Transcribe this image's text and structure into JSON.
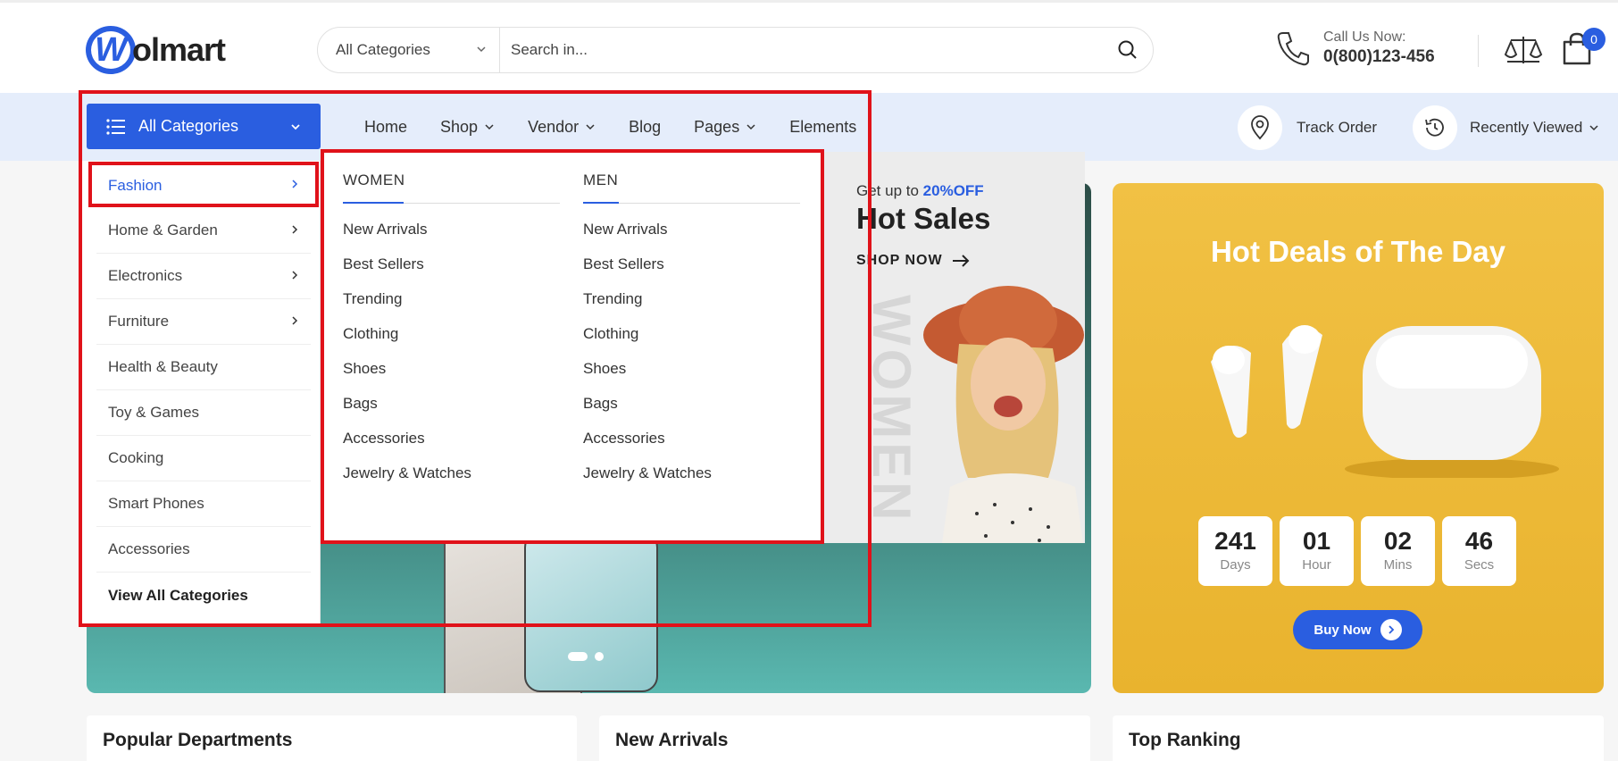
{
  "header": {
    "logo_text": "olmart",
    "logo_mark": "W",
    "search": {
      "category": "All Categories",
      "placeholder": "Search in..."
    },
    "call_label": "Call Us Now:",
    "call_number": "0(800)123-456",
    "cart_count": "0"
  },
  "nav": {
    "all_categories": "All Categories",
    "links": [
      "Home",
      "Shop",
      "Vendor",
      "Blog",
      "Pages",
      "Elements"
    ],
    "track_order": "Track Order",
    "recently_viewed": "Recently Viewed"
  },
  "categories": [
    "Fashion",
    "Home & Garden",
    "Electronics",
    "Furniture",
    "Health & Beauty",
    "Toy & Games",
    "Cooking",
    "Smart Phones",
    "Accessories",
    "View All Categories"
  ],
  "mega_menu": {
    "women": {
      "heading": "WOMEN",
      "links": [
        "New Arrivals",
        "Best Sellers",
        "Trending",
        "Clothing",
        "Shoes",
        "Bags",
        "Accessories",
        "Jewelry & Watches"
      ]
    },
    "men": {
      "heading": "MEN",
      "links": [
        "New Arrivals",
        "Best Sellers",
        "Trending",
        "Clothing",
        "Shoes",
        "Bags",
        "Accessories",
        "Jewelry & Watches"
      ]
    }
  },
  "promo": {
    "pre": "Get up to",
    "highlight": "20%OFF",
    "title": "Hot Sales",
    "cta": "SHOP NOW",
    "watermark": "WOMEN"
  },
  "deals": {
    "title": "Hot Deals of The Day",
    "timer": [
      {
        "value": "241",
        "label": "Days"
      },
      {
        "value": "01",
        "label": "Hour"
      },
      {
        "value": "02",
        "label": "Mins"
      },
      {
        "value": "46",
        "label": "Secs"
      }
    ],
    "cta": "Buy Now"
  },
  "sections": [
    "Popular Departments",
    "New Arrivals",
    "Top Ranking"
  ],
  "colors": {
    "brand": "#2a5ee0",
    "annotation": "#e0121a"
  }
}
